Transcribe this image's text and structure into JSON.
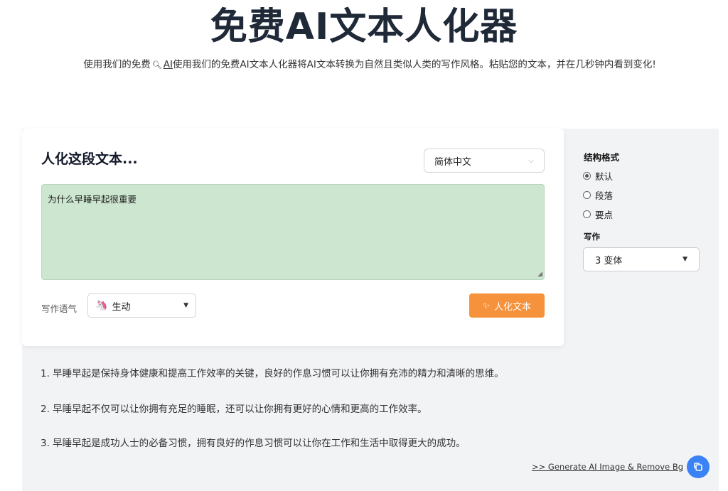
{
  "header": {
    "title": "免费AI文本人化器",
    "subtitle_prefix": "使用我们的免费",
    "subtitle_link": "AI",
    "subtitle_rest": "使用我们的免费AI文本人化器将AI文本转换为自然且类似人类的写作风格。粘贴您的文本，并在几秒钟内看到变化!"
  },
  "editor": {
    "heading": "人化这段文本...",
    "language": "简体中文",
    "input_text": "为什么早睡早起很重要",
    "tone_label": "写作语气",
    "tone_value": "生动",
    "tone_emoji": "🦄",
    "submit_label": "人化文本"
  },
  "options": {
    "structure_label": "结构格式",
    "structure_options": [
      "默认",
      "段落",
      "要点"
    ],
    "structure_selected": 0,
    "writing_label": "写作",
    "variants_value": "3 变体"
  },
  "results": [
    "1. 早睡早起是保持身体健康和提高工作效率的关键，良好的作息习惯可以让你拥有充沛的精力和清晰的思维。",
    "2. 早睡早起不仅可以让你拥有充足的睡眠，还可以让你拥有更好的心情和更高的工作效率。",
    "3. 早睡早起是成功人士的必备习惯，拥有良好的作息习惯可以让你在工作和生活中取得更大的成功。"
  ],
  "footer": {
    "generate_link": ">> Generate AI Image & Remove Bg"
  },
  "colors": {
    "accent_button": "#f6923b",
    "input_background": "#cce6cf",
    "copy_button": "#3b82f6"
  }
}
